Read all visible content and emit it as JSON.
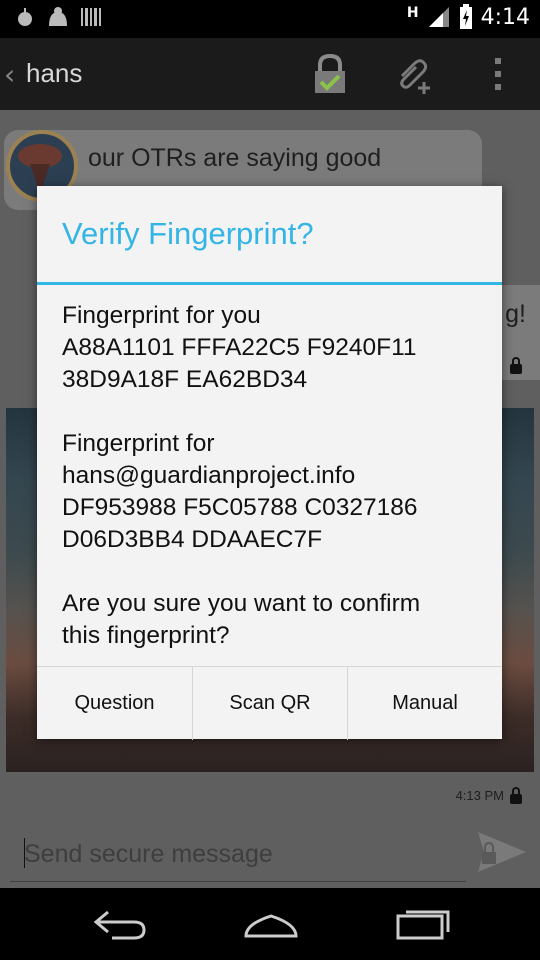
{
  "status_bar": {
    "network_type": "H",
    "time": "4:14"
  },
  "action_bar": {
    "title": "hans"
  },
  "chat": {
    "messages": [
      {
        "text": "our OTRs are saying good"
      },
      {
        "text": "g!"
      }
    ],
    "timestamp": "4:13 PM",
    "composer_placeholder": "Send secure message"
  },
  "dialog": {
    "title": "Verify Fingerprint?",
    "your_fingerprint": {
      "label": "Fingerprint for you",
      "line1": "A88A1101 FFFA22C5 F9240F11",
      "line2": "38D9A18F EA62BD34"
    },
    "their_fingerprint": {
      "label": "Fingerprint for",
      "account": "hans@guardianproject.info",
      "line1": "DF953988 F5C05788 C0327186",
      "line2": "D06D3BB4 DDAAEC7F"
    },
    "confirm_line1": "Are you sure you want to confirm",
    "confirm_line2": "this fingerprint?",
    "buttons": {
      "question": "Question",
      "scan_qr": "Scan QR",
      "manual": "Manual"
    }
  },
  "colors": {
    "accent": "#33b5e5",
    "dialog_bg": "#f3f3f3",
    "verified_check": "#8bc34a"
  }
}
